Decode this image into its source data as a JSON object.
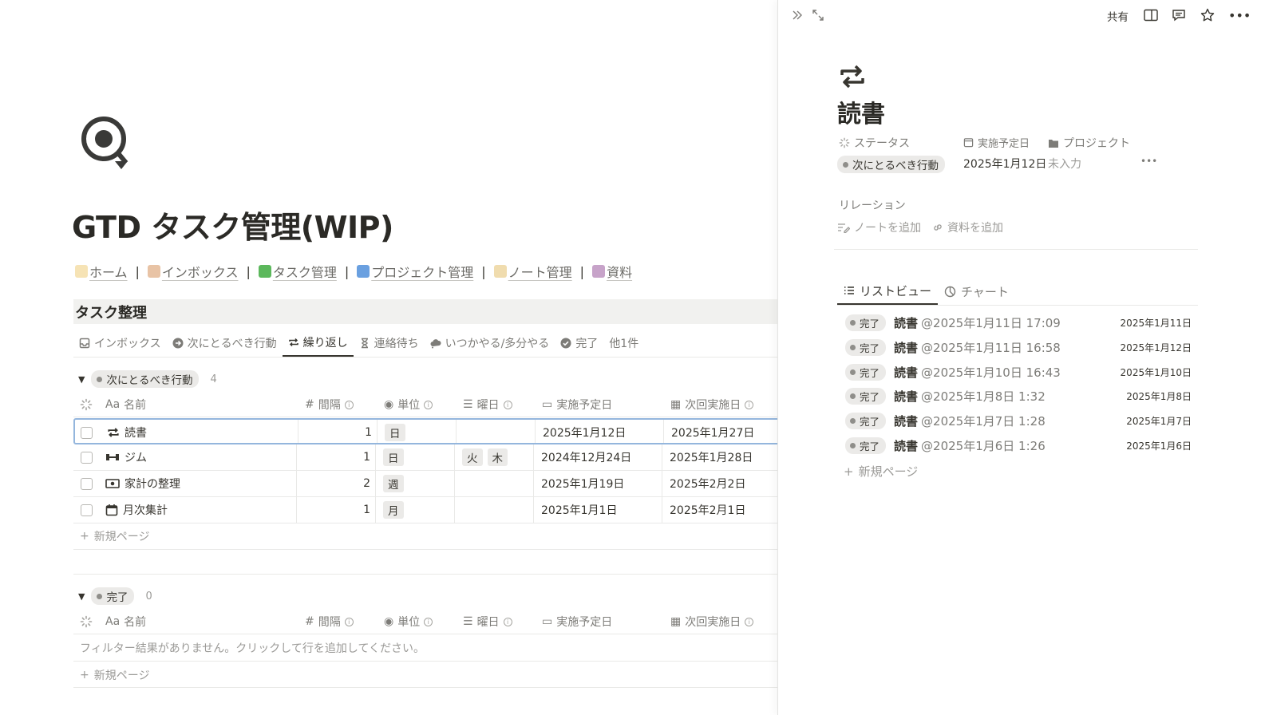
{
  "page": {
    "title": "GTD タスク管理(WIP)",
    "icon": "sync-search-icon",
    "nav_links": [
      "ホーム",
      "インボックス",
      "タスク管理",
      "プロジェクト管理",
      "ノート管理",
      "資料"
    ],
    "nav_separator": "|"
  },
  "section": {
    "title": "タスク整理"
  },
  "tabs": [
    {
      "label": "インボックス",
      "icon": "inbox-icon"
    },
    {
      "label": "次にとるべき行動",
      "icon": "arrow-circle-icon"
    },
    {
      "label": "繰り返し",
      "icon": "repeat-icon",
      "active": true
    },
    {
      "label": "連絡待ち",
      "icon": "hourglass-icon"
    },
    {
      "label": "いつかやる/多分やる",
      "icon": "cloud-icon"
    },
    {
      "label": "完了",
      "icon": "check-circle-icon"
    },
    {
      "label": "他1件",
      "icon": ""
    }
  ],
  "columns": {
    "name": "名前",
    "name_prefix": "Aa",
    "interval": "間隔",
    "unit": "単位",
    "weekday": "曜日",
    "scheduled": "実施予定日",
    "next": "次回実施日"
  },
  "group1": {
    "status": "次にとるべき行動",
    "count": "4",
    "rows": [
      {
        "icon": "repeat-icon",
        "name": "読書",
        "interval": "1",
        "unit": "日",
        "weekdays": [],
        "scheduled": "2025年1月12日",
        "next": "2025年1月27日"
      },
      {
        "icon": "dumbbell-icon",
        "name": "ジム",
        "interval": "1",
        "unit": "日",
        "weekdays": [
          "火",
          "木"
        ],
        "scheduled": "2024年12月24日",
        "next": "2025年1月28日"
      },
      {
        "icon": "money-icon",
        "name": "家計の整理",
        "interval": "2",
        "unit": "週",
        "weekdays": [],
        "scheduled": "2025年1月19日",
        "next": "2025年2月2日"
      },
      {
        "icon": "calendar-icon",
        "name": "月次集計",
        "interval": "1",
        "unit": "月",
        "weekdays": [],
        "scheduled": "2025年1月1日",
        "next": "2025年2月1日"
      }
    ],
    "new_page": "新規ページ"
  },
  "group2": {
    "status": "完了",
    "count": "0",
    "empty_text": "フィルター結果がありません。クリックして行を追加してください。",
    "new_page": "新規ページ"
  },
  "panel": {
    "share": "共有",
    "icon": "repeat-icon",
    "title": "読書",
    "props": {
      "status_label": "ステータス",
      "status_value": "次にとるべき行動",
      "date_label": "実施予定日",
      "date_value": "2025年1月12日",
      "project_label": "プロジェクト",
      "project_value": "未入力",
      "more": "•••"
    },
    "relation_label": "リレーション",
    "add_note": "ノートを追加",
    "add_material": "資料を追加",
    "view_tabs": [
      {
        "label": "リストビュー",
        "icon": "list-icon",
        "active": true
      },
      {
        "label": "チャート",
        "icon": "chart-icon"
      }
    ],
    "list": [
      {
        "status": "完了",
        "name": "読書",
        "mention": "@2025年1月11日 17:09",
        "date": "2025年1月11日"
      },
      {
        "status": "完了",
        "name": "読書",
        "mention": "@2025年1月11日 16:58",
        "date": "2025年1月12日"
      },
      {
        "status": "完了",
        "name": "読書",
        "mention": "@2025年1月10日 16:43",
        "date": "2025年1月10日"
      },
      {
        "status": "完了",
        "name": "読書",
        "mention": "@2025年1月8日 1:32",
        "date": "2025年1月8日"
      },
      {
        "status": "完了",
        "name": "読書",
        "mention": "@2025年1月7日 1:28",
        "date": "2025年1月7日"
      },
      {
        "status": "完了",
        "name": "読書",
        "mention": "@2025年1月6日 1:26",
        "date": "2025年1月6日"
      }
    ],
    "new_page": "新規ページ"
  }
}
